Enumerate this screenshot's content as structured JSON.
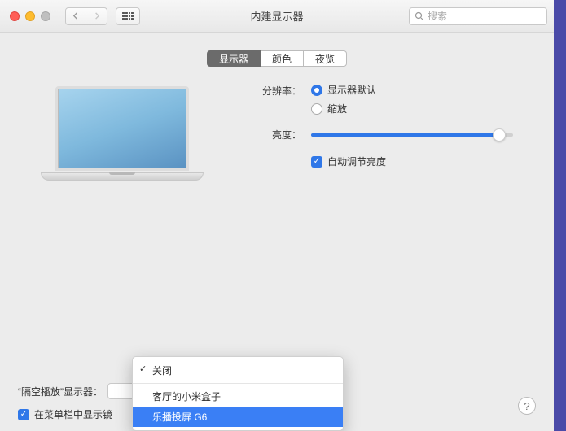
{
  "window": {
    "title": "内建显示器"
  },
  "search": {
    "placeholder": "搜索"
  },
  "tabs": [
    {
      "label": "显示器",
      "active": true
    },
    {
      "label": "颜色",
      "active": false
    },
    {
      "label": "夜览",
      "active": false
    }
  ],
  "resolution": {
    "label": "分辨率：",
    "options": [
      {
        "label": "显示器默认",
        "checked": true
      },
      {
        "label": "缩放",
        "checked": false
      }
    ]
  },
  "brightness": {
    "label": "亮度：",
    "value": 93
  },
  "auto_brightness": {
    "label": "自动调节亮度",
    "checked": true
  },
  "airplay": {
    "label": "“隔空播放”显示器：",
    "options": [
      {
        "label": "关闭",
        "selected": true
      },
      {
        "label": "客厅的小米盒子",
        "selected": false
      },
      {
        "label": "乐播投屏 G6",
        "selected": false,
        "hover": true
      }
    ]
  },
  "menubar_mirror": {
    "label": "在菜单栏中显示镜",
    "checked": true
  },
  "help": "?"
}
